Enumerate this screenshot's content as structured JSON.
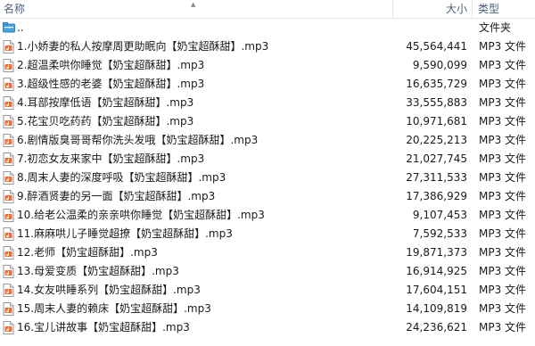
{
  "header": {
    "name_label": "名称",
    "size_label": "大小",
    "type_label": "类型"
  },
  "parent_row": {
    "name": "..",
    "type": "文件夹",
    "icon": "folder-up-icon"
  },
  "files": [
    {
      "name": "1.小娇妻的私人按摩周更助眠向【奶宝超酥甜】.mp3",
      "size": "45,564,441",
      "type": "MP3 文件"
    },
    {
      "name": "2.超温柔哄你睡觉【奶宝超酥甜】.mp3",
      "size": "9,590,099",
      "type": "MP3 文件"
    },
    {
      "name": "3.超级性感的老婆【奶宝超酥甜】.mp3",
      "size": "16,635,729",
      "type": "MP3 文件"
    },
    {
      "name": "4.耳部按摩低语【奶宝超酥甜】.mp3",
      "size": "33,555,883",
      "type": "MP3 文件"
    },
    {
      "name": "5.花宝贝吃药药【奶宝超酥甜】.mp3",
      "size": "10,971,681",
      "type": "MP3 文件"
    },
    {
      "name": "6.剧情版臭哥哥帮你洗头发哦【奶宝超酥甜】.mp3",
      "size": "20,225,213",
      "type": "MP3 文件"
    },
    {
      "name": "7.初恋女友来家中【奶宝超酥甜】.mp3",
      "size": "21,027,745",
      "type": "MP3 文件"
    },
    {
      "name": "8.周末人妻的深度呼吸【奶宝超酥甜】.mp3",
      "size": "27,311,533",
      "type": "MP3 文件"
    },
    {
      "name": "9.醉酒贤妻的另一面【奶宝超酥甜】.mp3",
      "size": "17,386,929",
      "type": "MP3 文件"
    },
    {
      "name": "10.给老公温柔的亲亲哄你睡觉【奶宝超酥甜】.mp3",
      "size": "9,107,453",
      "type": "MP3 文件"
    },
    {
      "name": "11.麻麻哄儿子睡觉超撩【奶宝超酥甜】.mp3",
      "size": "7,592,533",
      "type": "MP3 文件"
    },
    {
      "name": "12.老师【奶宝超酥甜】.mp3",
      "size": "19,871,373",
      "type": "MP3 文件"
    },
    {
      "name": "13.母爱变质【奶宝超酥甜】.mp3",
      "size": "16,914,925",
      "type": "MP3 文件"
    },
    {
      "name": "14.女友哄睡系列【奶宝超酥甜】.mp3",
      "size": "17,604,151",
      "type": "MP3 文件"
    },
    {
      "name": "15.周末人妻的赖床【奶宝超酥甜】.mp3",
      "size": "14,109,819",
      "type": "MP3 文件"
    },
    {
      "name": "16.宝儿讲故事【奶宝超酥甜】.mp3",
      "size": "24,236,621",
      "type": "MP3 文件"
    }
  ],
  "file_icon": "mp3-file-icon",
  "colors": {
    "header_text": "#4c607a",
    "separator": "#e5e5e5",
    "icon_accent": "#e8703a"
  }
}
